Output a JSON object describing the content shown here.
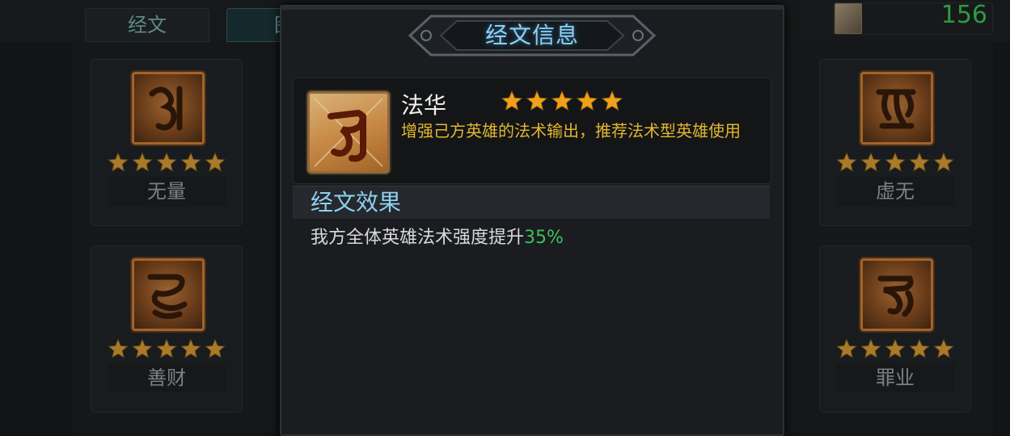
{
  "tabs": [
    {
      "label": "经文"
    },
    {
      "label": "图"
    }
  ],
  "currency": {
    "value": "156",
    "icon": "scroll-icon"
  },
  "colors": {
    "star": "#f0a01a",
    "desc": "#e3b72f",
    "title": "#8fd0f0",
    "highlight": "#3fc05a"
  },
  "cards": [
    {
      "name": "无量",
      "stars": 5,
      "icon": "sanskrit-rune-icon"
    },
    {
      "name": "善财",
      "stars": 5,
      "icon": "sanskrit-rune-icon"
    },
    {
      "name": "虚无",
      "stars": 5,
      "icon": "sanskrit-rune-icon"
    },
    {
      "name": "罪业",
      "stars": 5,
      "icon": "sanskrit-rune-icon"
    }
  ],
  "modal": {
    "title": "经文信息",
    "item": {
      "name": "法华",
      "stars": 5,
      "description": "增强己方英雄的法术输出，推荐法术型英雄使用",
      "icon": "sanskrit-rune-icon"
    },
    "effect": {
      "header": "经文效果",
      "text": "我方全体英雄法术强度提升",
      "value": "35%"
    }
  }
}
